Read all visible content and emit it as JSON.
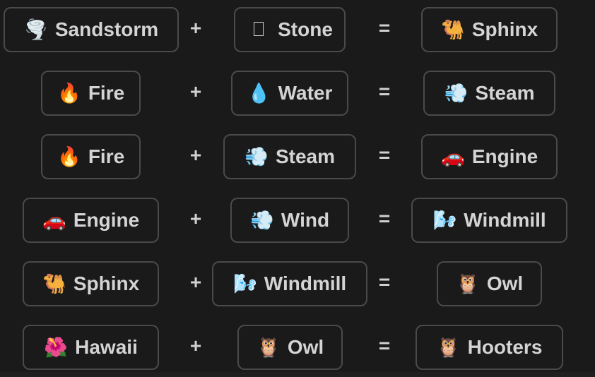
{
  "recipes": [
    {
      "first": {
        "label": "Sandstorm",
        "icon": "🌪️",
        "icon_name": "tornado"
      },
      "operator_plus": "+",
      "second": {
        "label": "Stone",
        "icon": "",
        "icon_name": "missing-glyph"
      },
      "operator_equals": "=",
      "result": {
        "label": "Sphinx",
        "icon": "🐫",
        "icon_name": "camel"
      }
    },
    {
      "first": {
        "label": "Fire",
        "icon": "🔥",
        "icon_name": "fire"
      },
      "operator_plus": "+",
      "second": {
        "label": "Water",
        "icon": "💧",
        "icon_name": "droplet"
      },
      "operator_equals": "=",
      "result": {
        "label": "Steam",
        "icon": "💨",
        "icon_name": "dash"
      }
    },
    {
      "first": {
        "label": "Fire",
        "icon": "🔥",
        "icon_name": "fire"
      },
      "operator_plus": "+",
      "second": {
        "label": "Steam",
        "icon": "💨",
        "icon_name": "dash"
      },
      "operator_equals": "=",
      "result": {
        "label": "Engine",
        "icon": "🚗",
        "icon_name": "car"
      }
    },
    {
      "first": {
        "label": "Engine",
        "icon": "🚗",
        "icon_name": "car"
      },
      "operator_plus": "+",
      "second": {
        "label": "Wind",
        "icon": "💨",
        "icon_name": "dash"
      },
      "operator_equals": "=",
      "result": {
        "label": "Windmill",
        "icon": "🌬️",
        "icon_name": "wind-face"
      }
    },
    {
      "first": {
        "label": "Sphinx",
        "icon": "🐫",
        "icon_name": "camel"
      },
      "operator_plus": "+",
      "second": {
        "label": "Windmill",
        "icon": "🌬️",
        "icon_name": "wind-face"
      },
      "operator_equals": "=",
      "result": {
        "label": "Owl",
        "icon": "🦉",
        "icon_name": "owl"
      }
    },
    {
      "first": {
        "label": "Hawaii",
        "icon": "🌺",
        "icon_name": "hibiscus"
      },
      "operator_plus": "+",
      "second": {
        "label": "Owl",
        "icon": "🦉",
        "icon_name": "owl"
      },
      "operator_equals": "=",
      "result": {
        "label": "Hooters",
        "icon": "🦉",
        "icon_name": "owl"
      }
    }
  ]
}
